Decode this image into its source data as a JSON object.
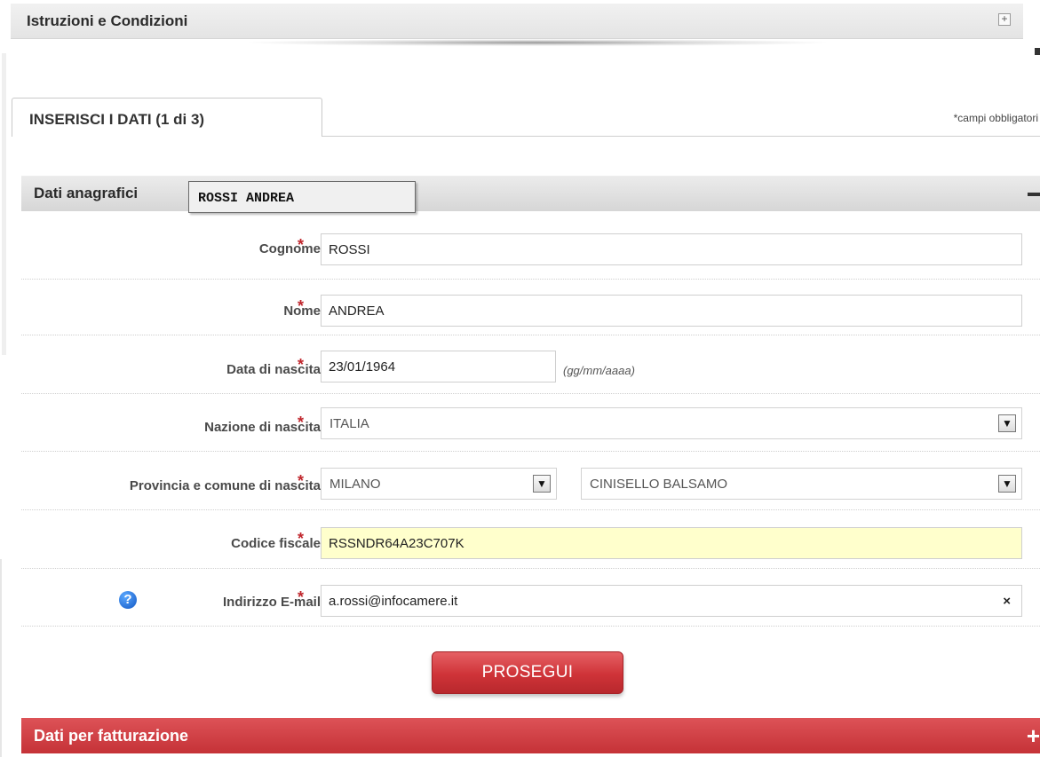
{
  "instructions": {
    "title": "Istruzioni e Condizioni",
    "expand_symbol": "+"
  },
  "tab": {
    "label": "INSERISCI I DATI (1 di 3)",
    "required_note": "*campi obbligatori"
  },
  "personal_section": {
    "title": "Dati anagrafici",
    "tooltip": "ROSSI ANDREA",
    "collapse_symbol": "−"
  },
  "form": {
    "required_mark": "*",
    "surname": {
      "label": "Cognome",
      "value": "ROSSI"
    },
    "name": {
      "label": "Nome",
      "value": "ANDREA"
    },
    "birth_date": {
      "label": "Data di nascita",
      "value": "23/01/1964",
      "hint": "(gg/mm/aaaa)"
    },
    "birth_country": {
      "label": "Nazione di nascita",
      "value": "ITALIA"
    },
    "birth_place": {
      "label": "Provincia e comune di nascita",
      "province": "MILANO",
      "municipality": "CINISELLO BALSAMO"
    },
    "tax_code": {
      "label": "Codice fiscale",
      "value": "RSSNDR64A23C707K"
    },
    "email": {
      "label": "Indirizzo E-mail",
      "value": "a.rossi@infocamere.it",
      "help_symbol": "?",
      "clear_symbol": "×"
    }
  },
  "actions": {
    "continue_label": "PROSEGUI"
  },
  "billing_section": {
    "title": "Dati per fatturazione",
    "expand_symbol": "+"
  },
  "colors": {
    "accent_red": "#cf3338",
    "highlight_yellow": "#ffffcc",
    "required_red": "#c0272d"
  },
  "icons": {
    "instructions_expand": "plus-box-icon",
    "personal_collapse": "minus-icon",
    "select_arrow": "chevron-down-icon",
    "email_help": "question-circle-icon",
    "email_clear": "clear-x-icon",
    "billing_expand": "plus-icon"
  }
}
